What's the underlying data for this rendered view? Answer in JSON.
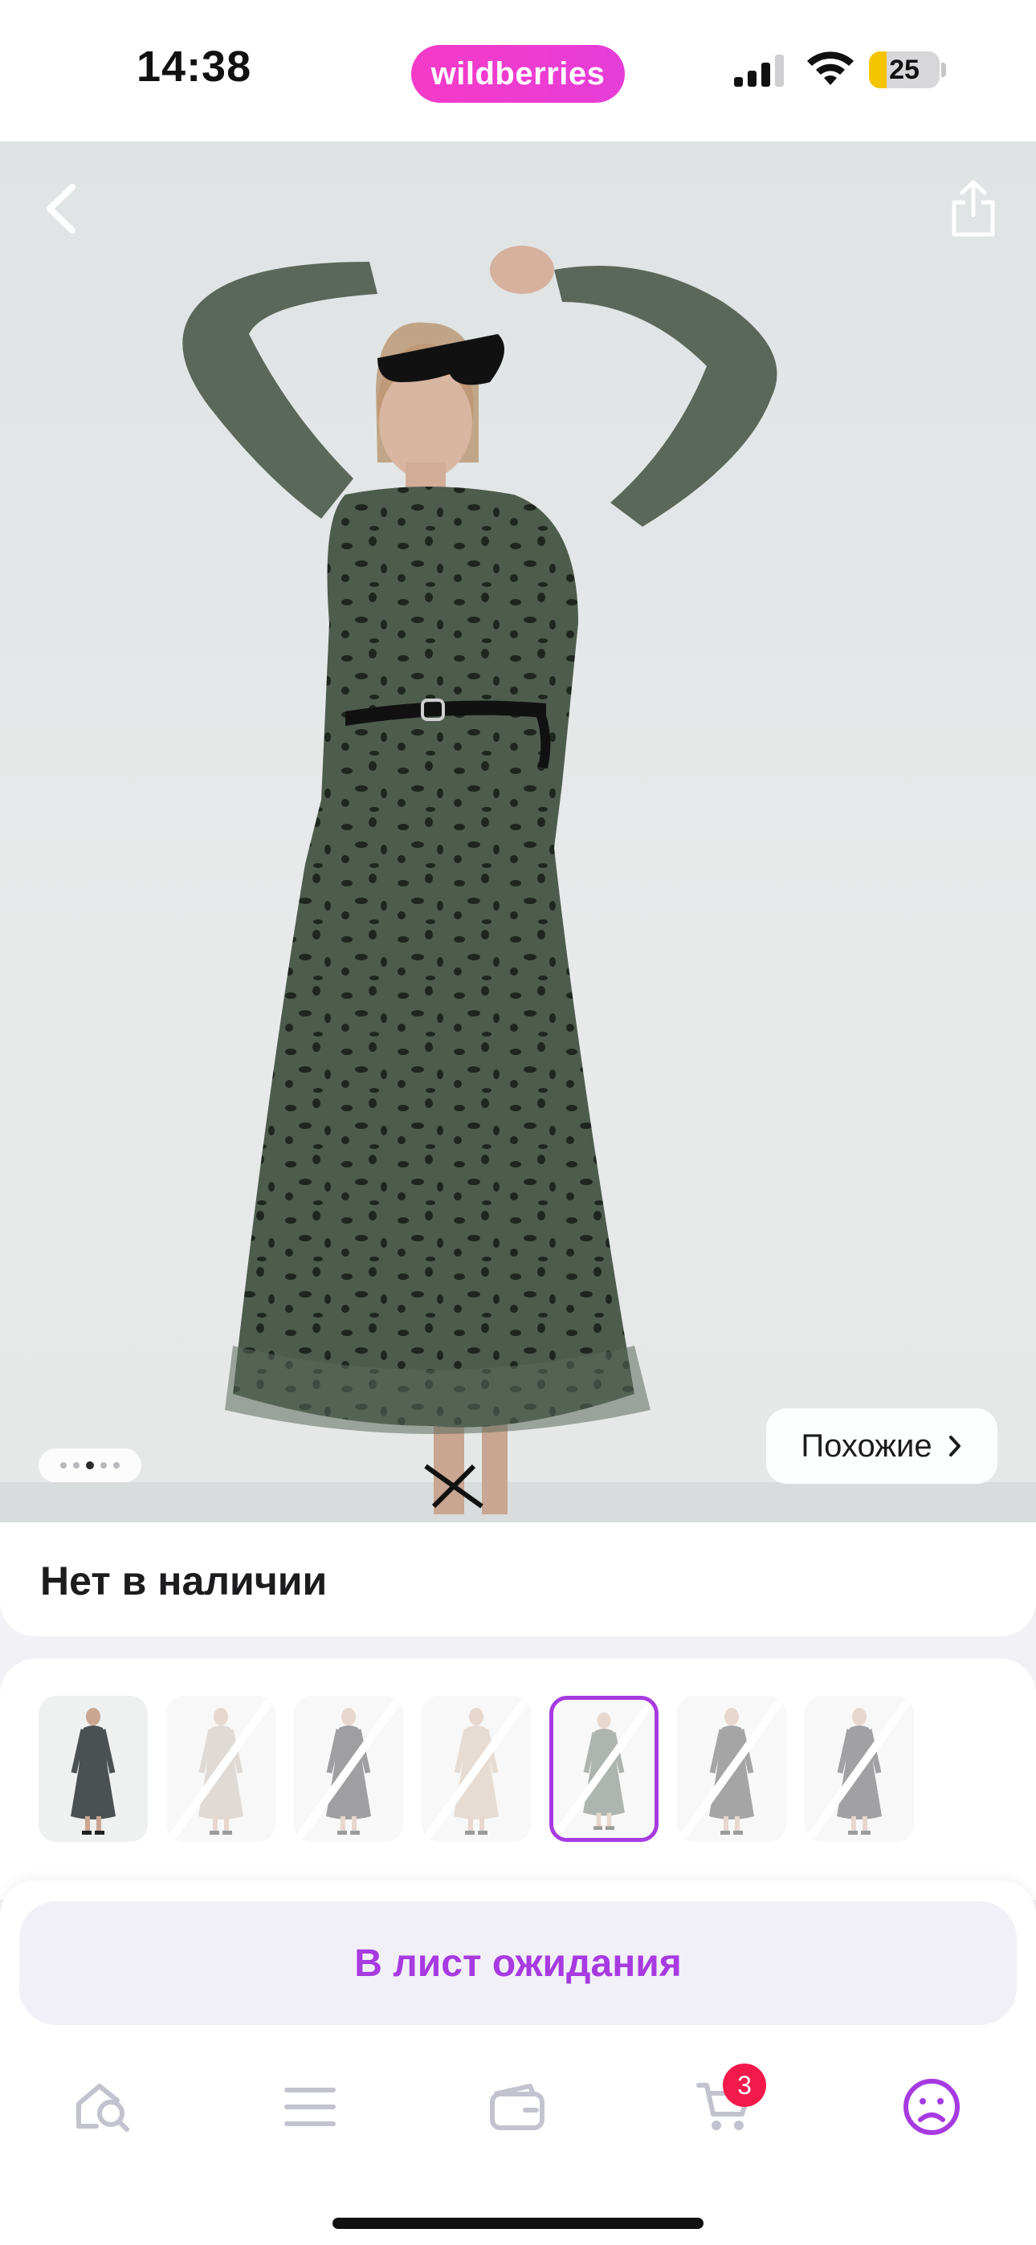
{
  "status_bar": {
    "time": "14:38",
    "brand": "wildberries",
    "battery_level": "25",
    "battery_fraction": 0.25
  },
  "product": {
    "image_description": "model-in-green-spotted-mesh-dress",
    "pager": {
      "count": 5,
      "active_index": 2
    },
    "similar_label": "Похожие",
    "back_icon": "chevron-left-icon",
    "share_icon": "share-icon"
  },
  "stock": {
    "status_text": "Нет в наличии"
  },
  "variants": [
    {
      "available": true,
      "dress_color": "#4b5152",
      "selected": false
    },
    {
      "available": false,
      "dress_color": "#b8aea3",
      "selected": false
    },
    {
      "available": false,
      "dress_color": "#2c2c2f",
      "selected": false
    },
    {
      "available": false,
      "dress_color": "#c9b19e",
      "selected": false
    },
    {
      "available": false,
      "dress_color": "#4d5a4f",
      "selected": true
    },
    {
      "available": false,
      "dress_color": "#38393b",
      "selected": false
    },
    {
      "available": false,
      "dress_color": "#2f3033",
      "selected": false
    }
  ],
  "action": {
    "waitlist_label": "В лист ожидания"
  },
  "tab_bar": {
    "items": [
      {
        "icon": "search-home-icon"
      },
      {
        "icon": "menu-icon"
      },
      {
        "icon": "wallet-icon"
      },
      {
        "icon": "cart-icon"
      },
      {
        "icon": "profile-icon"
      }
    ],
    "cart_count": "3",
    "active_color": "#a73ae0",
    "inactive_color": "#c3c3cf"
  },
  "colors": {
    "accent": "#a73ae0",
    "brand_pink": "#f53ac8",
    "badge_red": "#f4194b",
    "battery_yellow": "#f5c400"
  }
}
